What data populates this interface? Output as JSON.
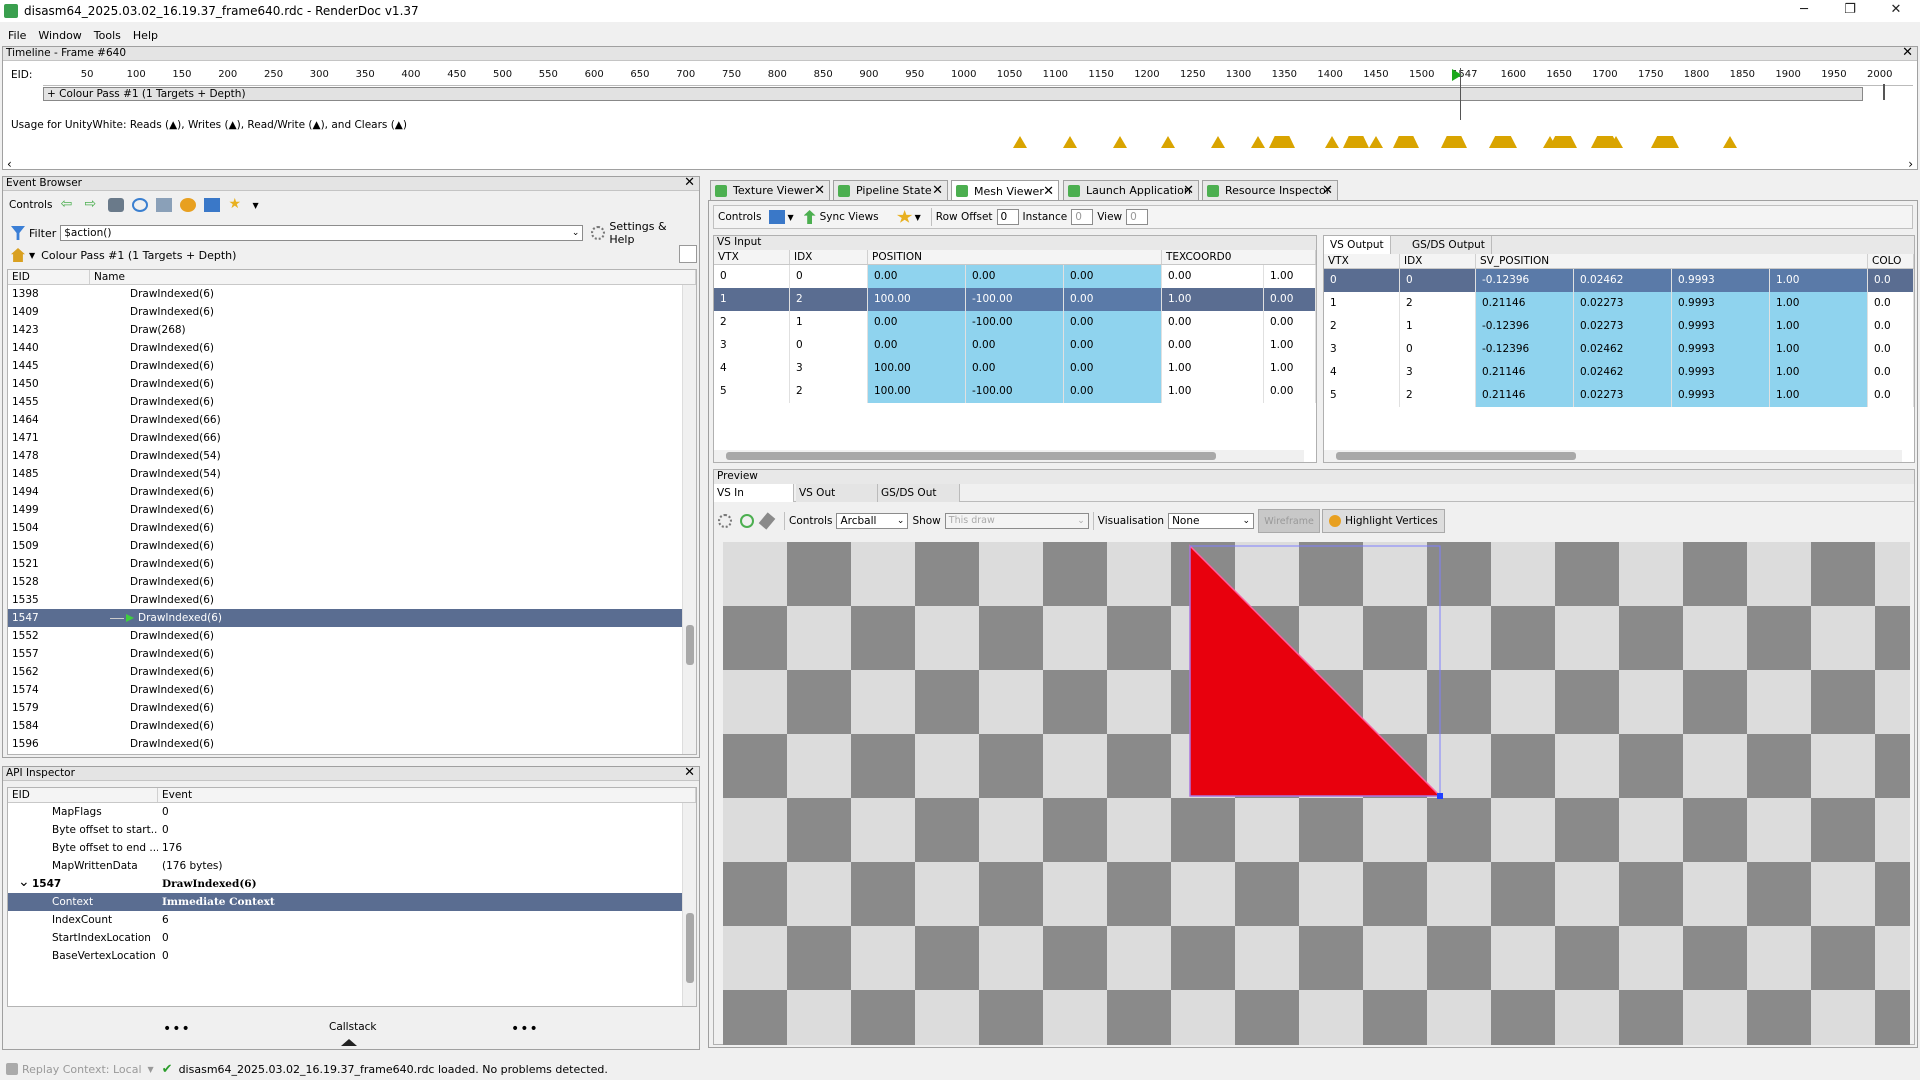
{
  "window": {
    "title": "disasm64_2025.03.02_16.19.37_frame640.rdc - RenderDoc v1.37",
    "minimize": "─",
    "restore": "❐",
    "close": "✕"
  },
  "menu": [
    "File",
    "Window",
    "Tools",
    "Help"
  ],
  "timeline": {
    "title": "Timeline - Frame #640",
    "eid_label": "EID:",
    "ticks": [
      "50",
      "100",
      "150",
      "200",
      "250",
      "300",
      "350",
      "400",
      "450",
      "500",
      "550",
      "600",
      "650",
      "700",
      "750",
      "800",
      "850",
      "900",
      "950",
      "1000",
      "1050",
      "1100",
      "1150",
      "1200",
      "1250",
      "1300",
      "1350",
      "1400",
      "1450",
      "1500",
      "1547",
      "1600",
      "1650",
      "1700",
      "1750",
      "1800",
      "1850",
      "1900",
      "1950",
      "2000"
    ],
    "pass_label": "+ Colour Pass #1 (1 Targets + Depth)",
    "usage": "Usage for UnityWhite: Reads (▲), Writes (▲), Read/Write (▲), and Clears (▲)",
    "marker_color": "#1aa81a",
    "usage_color": "#d9a400"
  },
  "event_browser": {
    "title": "Event Browser",
    "controls_label": "Controls",
    "filter_label": "Filter",
    "filter_value": "$action()",
    "settings_label": "Settings & Help",
    "breadcrumb": "Colour Pass #1 (1 Targets + Depth)",
    "col_eid": "EID",
    "col_name": "Name",
    "rows": [
      {
        "eid": "1398",
        "name": "DrawIndexed(6)"
      },
      {
        "eid": "1409",
        "name": "DrawIndexed(6)"
      },
      {
        "eid": "1423",
        "name": "Draw(268)"
      },
      {
        "eid": "1440",
        "name": "DrawIndexed(6)"
      },
      {
        "eid": "1445",
        "name": "DrawIndexed(6)"
      },
      {
        "eid": "1450",
        "name": "DrawIndexed(6)"
      },
      {
        "eid": "1455",
        "name": "DrawIndexed(6)"
      },
      {
        "eid": "1464",
        "name": "DrawIndexed(66)"
      },
      {
        "eid": "1471",
        "name": "DrawIndexed(66)"
      },
      {
        "eid": "1478",
        "name": "DrawIndexed(54)"
      },
      {
        "eid": "1485",
        "name": "DrawIndexed(54)"
      },
      {
        "eid": "1494",
        "name": "DrawIndexed(6)"
      },
      {
        "eid": "1499",
        "name": "DrawIndexed(6)"
      },
      {
        "eid": "1504",
        "name": "DrawIndexed(6)"
      },
      {
        "eid": "1509",
        "name": "DrawIndexed(6)"
      },
      {
        "eid": "1521",
        "name": "DrawIndexed(6)"
      },
      {
        "eid": "1528",
        "name": "DrawIndexed(6)"
      },
      {
        "eid": "1535",
        "name": "DrawIndexed(6)"
      },
      {
        "eid": "1547",
        "name": "DrawIndexed(6)",
        "selected": true
      },
      {
        "eid": "1552",
        "name": "DrawIndexed(6)"
      },
      {
        "eid": "1557",
        "name": "DrawIndexed(6)"
      },
      {
        "eid": "1562",
        "name": "DrawIndexed(6)"
      },
      {
        "eid": "1574",
        "name": "DrawIndexed(6)"
      },
      {
        "eid": "1579",
        "name": "DrawIndexed(6)"
      },
      {
        "eid": "1584",
        "name": "DrawIndexed(6)"
      },
      {
        "eid": "1596",
        "name": "DrawIndexed(6)"
      }
    ]
  },
  "api_inspector": {
    "title": "API Inspector",
    "col_eid": "EID",
    "col_event": "Event",
    "rows": [
      {
        "key": "MapFlags",
        "value": "0"
      },
      {
        "key": "Byte offset to start...",
        "value": "0"
      },
      {
        "key": "Byte offset to end ...",
        "value": "176"
      },
      {
        "key": "MapWrittenData",
        "value": "(176 bytes)"
      },
      {
        "key": "1547",
        "value": "DrawIndexed(6)",
        "group": true
      },
      {
        "key": "Context",
        "value": "Immediate Context",
        "selected": true
      },
      {
        "key": "IndexCount",
        "value": "6"
      },
      {
        "key": "StartIndexLocation",
        "value": "0"
      },
      {
        "key": "BaseVertexLocation",
        "value": "0"
      }
    ],
    "callstack": "Callstack",
    "dots": "•••"
  },
  "tabs": [
    {
      "label": "Texture Viewer"
    },
    {
      "label": "Pipeline State"
    },
    {
      "label": "Mesh Viewer",
      "active": true
    },
    {
      "label": "Launch Application"
    },
    {
      "label": "Resource Inspector"
    }
  ],
  "mesh_toolbar": {
    "controls": "Controls",
    "sync_views": "Sync Views",
    "row_offset_label": "Row Offset",
    "row_offset": "0",
    "instance_label": "Instance",
    "instance": "0",
    "view_label": "View",
    "view": "0"
  },
  "vs_input": {
    "title": "VS Input",
    "headers": [
      "VTX",
      "IDX",
      "POSITION",
      "",
      "",
      "TEXCOORD0",
      ""
    ],
    "rows": [
      [
        "0",
        "0",
        "0.00",
        "0.00",
        "0.00",
        "0.00",
        "1.00"
      ],
      [
        "1",
        "2",
        "100.00",
        "-100.00",
        "0.00",
        "1.00",
        "0.00"
      ],
      [
        "2",
        "1",
        "0.00",
        "-100.00",
        "0.00",
        "0.00",
        "0.00"
      ],
      [
        "3",
        "0",
        "0.00",
        "0.00",
        "0.00",
        "0.00",
        "1.00"
      ],
      [
        "4",
        "3",
        "100.00",
        "0.00",
        "0.00",
        "1.00",
        "1.00"
      ],
      [
        "5",
        "2",
        "100.00",
        "-100.00",
        "0.00",
        "1.00",
        "0.00"
      ]
    ],
    "selected_row": 1
  },
  "vs_output": {
    "tab_active": "VS Output",
    "tab_other": "GS/DS Output",
    "headers": [
      "VTX",
      "IDX",
      "SV_POSITION",
      "",
      "",
      "",
      "COLO"
    ],
    "rows": [
      [
        "0",
        "0",
        "-0.12396",
        "0.02462",
        "0.9993",
        "1.00",
        "0.0"
      ],
      [
        "1",
        "2",
        "0.21146",
        "0.02273",
        "0.9993",
        "1.00",
        "0.0"
      ],
      [
        "2",
        "1",
        "-0.12396",
        "0.02273",
        "0.9993",
        "1.00",
        "0.0"
      ],
      [
        "3",
        "0",
        "-0.12396",
        "0.02462",
        "0.9993",
        "1.00",
        "0.0"
      ],
      [
        "4",
        "3",
        "0.21146",
        "0.02462",
        "0.9993",
        "1.00",
        "0.0"
      ],
      [
        "5",
        "2",
        "0.21146",
        "0.02273",
        "0.9993",
        "1.00",
        "0.0"
      ]
    ],
    "selected_row": 0
  },
  "preview": {
    "title": "Preview",
    "tabs": [
      "VS In",
      "VS Out",
      "GS/DS Out"
    ],
    "controls_label": "Controls",
    "controls_value": "Arcball",
    "show_label": "Show",
    "show_value": "This draw",
    "visualisation_label": "Visualisation",
    "visualisation_value": "None",
    "wireframe_label": "Wireframe",
    "highlight_label": "Highlight Vertices",
    "mesh_color": "#e8000d"
  },
  "status": {
    "replay_context": "Replay Context: Local",
    "message": "disasm64_2025.03.02_16.19.37_frame640.rdc loaded. No problems detected."
  }
}
